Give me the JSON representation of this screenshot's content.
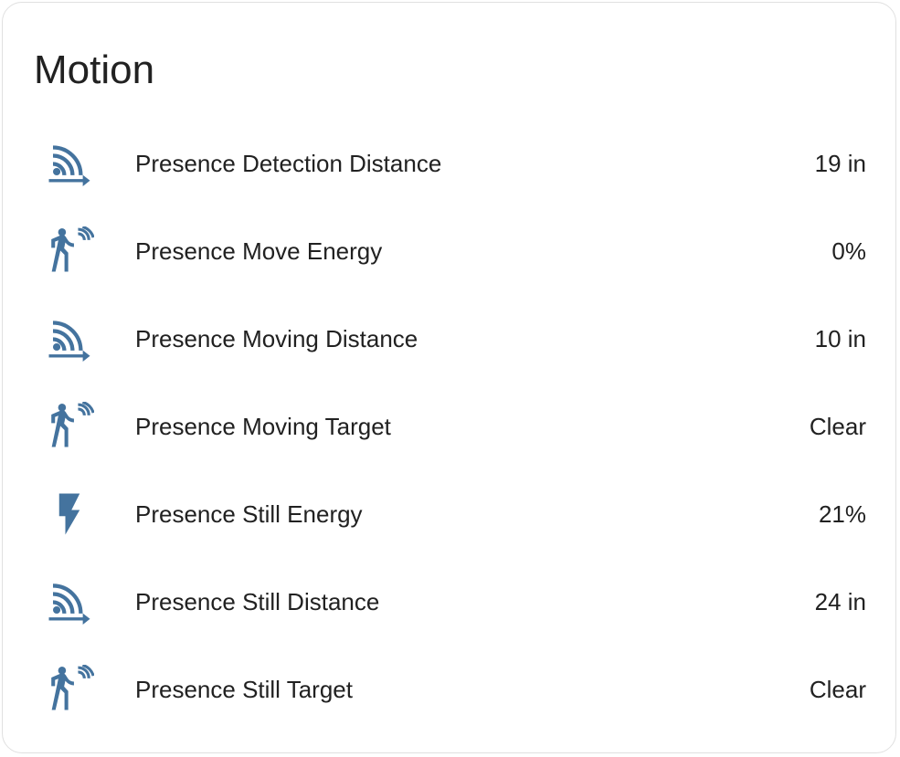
{
  "card": {
    "title": "Motion",
    "icon_color": "#44739e",
    "entities": [
      {
        "icon": "signal-distance-variant-icon",
        "name": "Presence Detection Distance",
        "state": "19 in"
      },
      {
        "icon": "motion-sensor-icon",
        "name": "Presence Move Energy",
        "state": "0%"
      },
      {
        "icon": "signal-distance-variant-icon",
        "name": "Presence Moving Distance",
        "state": "10 in"
      },
      {
        "icon": "motion-sensor-icon",
        "name": "Presence Moving Target",
        "state": "Clear"
      },
      {
        "icon": "flash-icon",
        "name": "Presence Still Energy",
        "state": "21%"
      },
      {
        "icon": "signal-distance-variant-icon",
        "name": "Presence Still Distance",
        "state": "24 in"
      },
      {
        "icon": "motion-sensor-icon",
        "name": "Presence Still Target",
        "state": "Clear"
      }
    ]
  }
}
